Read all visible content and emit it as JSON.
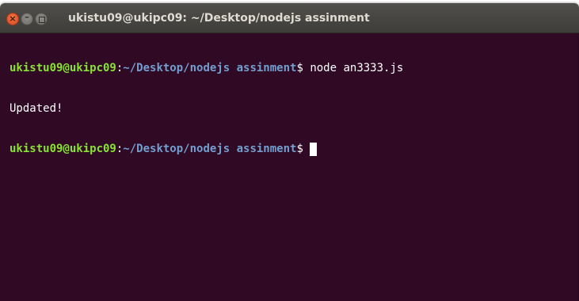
{
  "window": {
    "title": "ukistu09@ukipc09: ~/Desktop/nodejs assinment",
    "buttons": {
      "close_glyph": "×",
      "minimize_glyph": "–"
    }
  },
  "terminal": {
    "colors": {
      "background": "#300a24",
      "user_host": "#8ae234",
      "path": "#729fcf",
      "text": "#ffffff"
    },
    "lines": [
      {
        "user_host": "ukistu09@ukipc09",
        "separator": ":",
        "path": "~/Desktop/nodejs assinment",
        "prompt": "$ ",
        "command": "node an3333.js"
      },
      {
        "output": "Updated!"
      },
      {
        "user_host": "ukistu09@ukipc09",
        "separator": ":",
        "path": "~/Desktop/nodejs assinment",
        "prompt": "$ ",
        "command": ""
      }
    ]
  }
}
